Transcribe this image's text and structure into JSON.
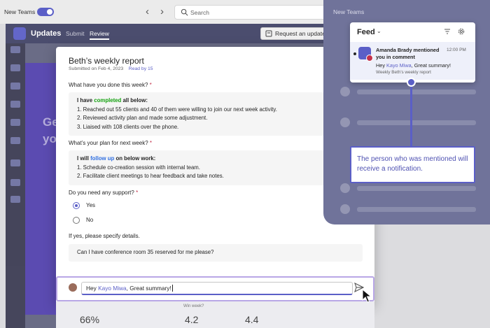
{
  "titlebar": {
    "new_teams_label": "New Teams",
    "nav_back": "‹",
    "nav_forward": "›",
    "search_placeholder": "Search"
  },
  "app": {
    "title": "Updates",
    "tabs": [
      {
        "label": "Submit",
        "active": false
      },
      {
        "label": "Review",
        "active": true
      }
    ],
    "request_button": "Request an update"
  },
  "form": {
    "title": "Beth’s weekly report",
    "submitted": "Submitted on Feb 4, 2023",
    "read_by": "Read by 15",
    "questions": [
      {
        "text": "What have you done this week?",
        "required_mark": "*",
        "answer_intro_pre": "I have ",
        "answer_intro_highlight": "completed",
        "answer_intro_post": " all below:",
        "items": [
          "1. Reached out 55 clients and 40 of them were willing to join our next week activity.",
          "2. Reviewed activity plan and made some adjustment.",
          "3. Liaised with 108 clients over the phone."
        ]
      },
      {
        "text": "What’s your plan for next week?",
        "required_mark": "*",
        "answer_intro_pre": "I will ",
        "answer_intro_highlight": "follow up",
        "answer_intro_post": " on below work:",
        "items": [
          "1. Schedule co-creation session with internal team.",
          "2. Facilitate client meetings to hear feedback and take notes."
        ]
      }
    ],
    "support_question": "Do you need any support?",
    "support_required_mark": "*",
    "options": [
      {
        "label": "Yes",
        "selected": true
      },
      {
        "label": "No",
        "selected": false
      }
    ],
    "details_question": "If yes, please specify details.",
    "details_answer": "Can I have conference room 35 reserved for me please?"
  },
  "comment": {
    "prefix": "Hey ",
    "mention": "Kayo Miwa",
    "suffix": ", Great summary!"
  },
  "stats": {
    "percent": "66%",
    "score1": "4.2",
    "score2": "4.4",
    "label": "Win week?"
  },
  "feed": {
    "overlay_new_teams": "New Teams",
    "title": "Feed",
    "notification": {
      "title": "Amanda Brady mentioned you in comment",
      "time": "12:00 PM",
      "message_prefix": "Hey ",
      "message_mention": "Kayo Miwa",
      "message_suffix": ", Great summary!",
      "context": "Weekly Beth’s weekly report"
    }
  },
  "callout": {
    "text": "The person who was mentioned will receive a notification."
  },
  "colors": {
    "brand": "#5b5fc7",
    "completed": "#13a10e",
    "follow_up": "#2f6ee0",
    "required": "#c4314b"
  }
}
